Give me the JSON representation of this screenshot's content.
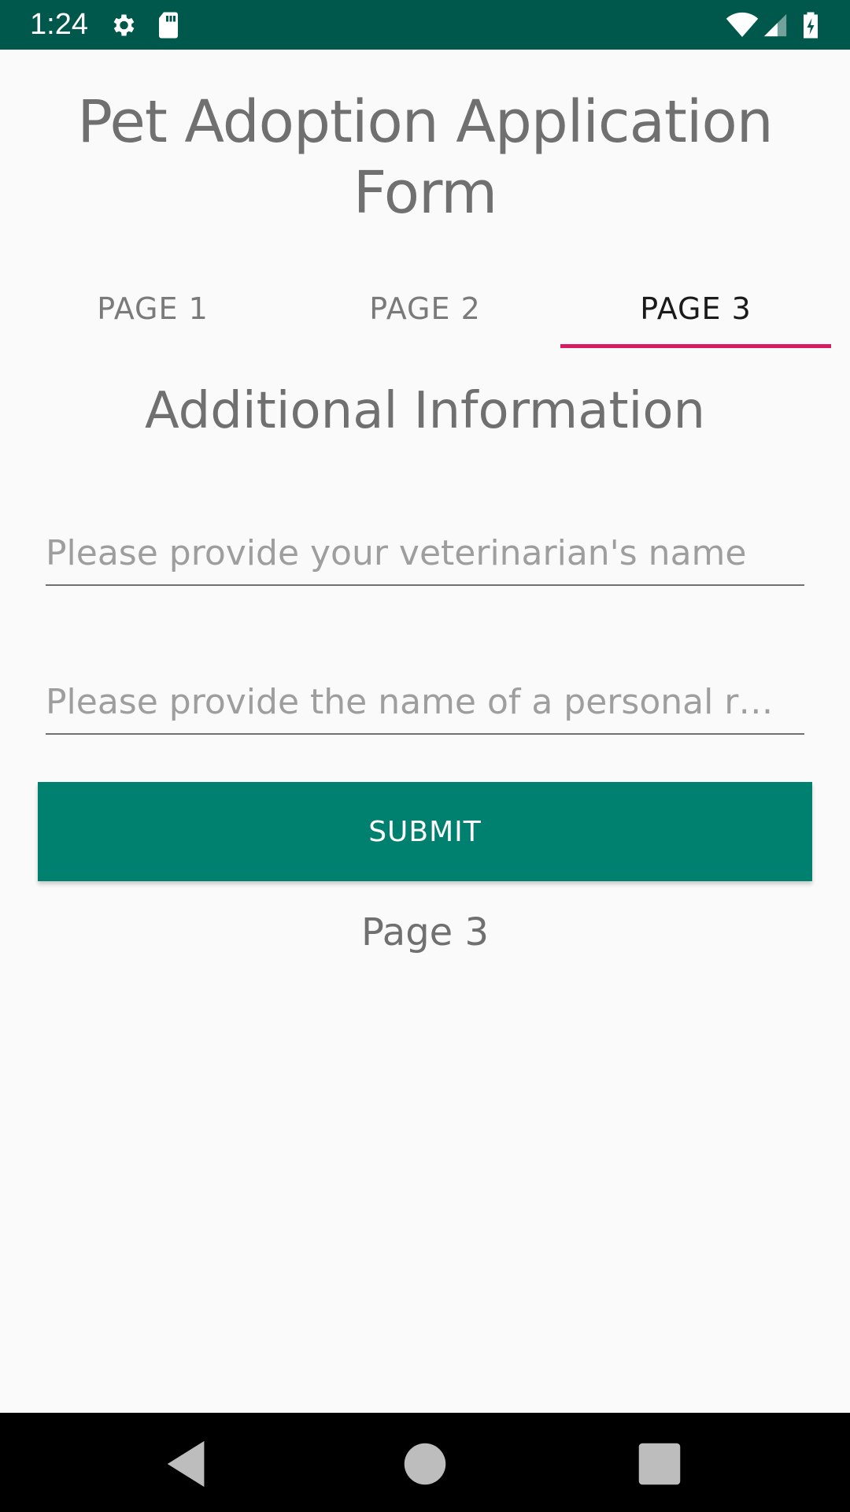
{
  "status_bar": {
    "time": "1:24",
    "icons": [
      "gear-icon",
      "sd-card-icon",
      "wifi-icon",
      "signal-icon",
      "battery-charging-icon"
    ]
  },
  "app": {
    "title": "Pet Adoption Application Form"
  },
  "tabs": [
    {
      "label": "PAGE 1",
      "selected": false
    },
    {
      "label": "PAGE 2",
      "selected": false
    },
    {
      "label": "PAGE 3",
      "selected": true
    }
  ],
  "form": {
    "section_title": "Additional Information",
    "vet_name": {
      "value": "",
      "placeholder": "Please provide your veterinarian's name"
    },
    "personal_reference": {
      "value": "",
      "placeholder": "Please provide the name of a personal r…"
    },
    "submit_label": "SUBMIT",
    "page_label": "Page 3"
  },
  "nav_bar": {
    "buttons": [
      "back-icon",
      "home-icon",
      "recents-icon"
    ]
  },
  "colors": {
    "status_bar": "#00574b",
    "accent": "#d81b60",
    "button": "#00806f",
    "background": "#fafafa"
  }
}
